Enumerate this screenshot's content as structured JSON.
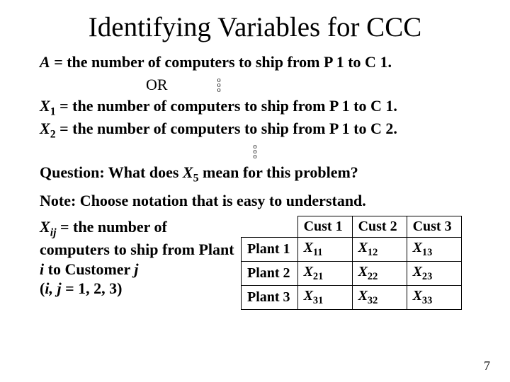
{
  "title": "Identifying Variables for CCC",
  "lineA_var": "A",
  "lineA_text": " = the number of computers to ship from P 1 to C 1.",
  "or": "OR",
  "lineX1_var": "X",
  "lineX1_sub": "1",
  "lineX1_text": " = the number of computers to ship from P 1 to C 1.",
  "lineX2_var": "X",
  "lineX2_sub": "2",
  "lineX2_text": " = the number of computers to ship from P 1 to C 2.",
  "question_pre": "Question: What does ",
  "question_var": "X",
  "question_sub": "5",
  "question_post": " mean for this problem?",
  "note": "Note: Choose notation that is easy to understand.",
  "xij_var": "X",
  "xij_sub": "ij",
  "xij_text1": " = the number of computers to ship  from Plant ",
  "xij_i": "i",
  "xij_text2": " to Customer ",
  "xij_j": "j",
  "xij_text3": "(",
  "xij_text3b": "i, j",
  "xij_text3c": " = 1, 2, 3)",
  "table": {
    "col1": "Cust 1",
    "col2": "Cust 2",
    "col3": "Cust 3",
    "row1": "Plant 1",
    "row2": "Plant 2",
    "row3": "Plant 3",
    "X": "X",
    "s11": "11",
    "s12": "12",
    "s13": "13",
    "s21": "21",
    "s22": "22",
    "s23": "23",
    "s31": "31",
    "s32": "32",
    "s33": "33"
  },
  "page": "7"
}
